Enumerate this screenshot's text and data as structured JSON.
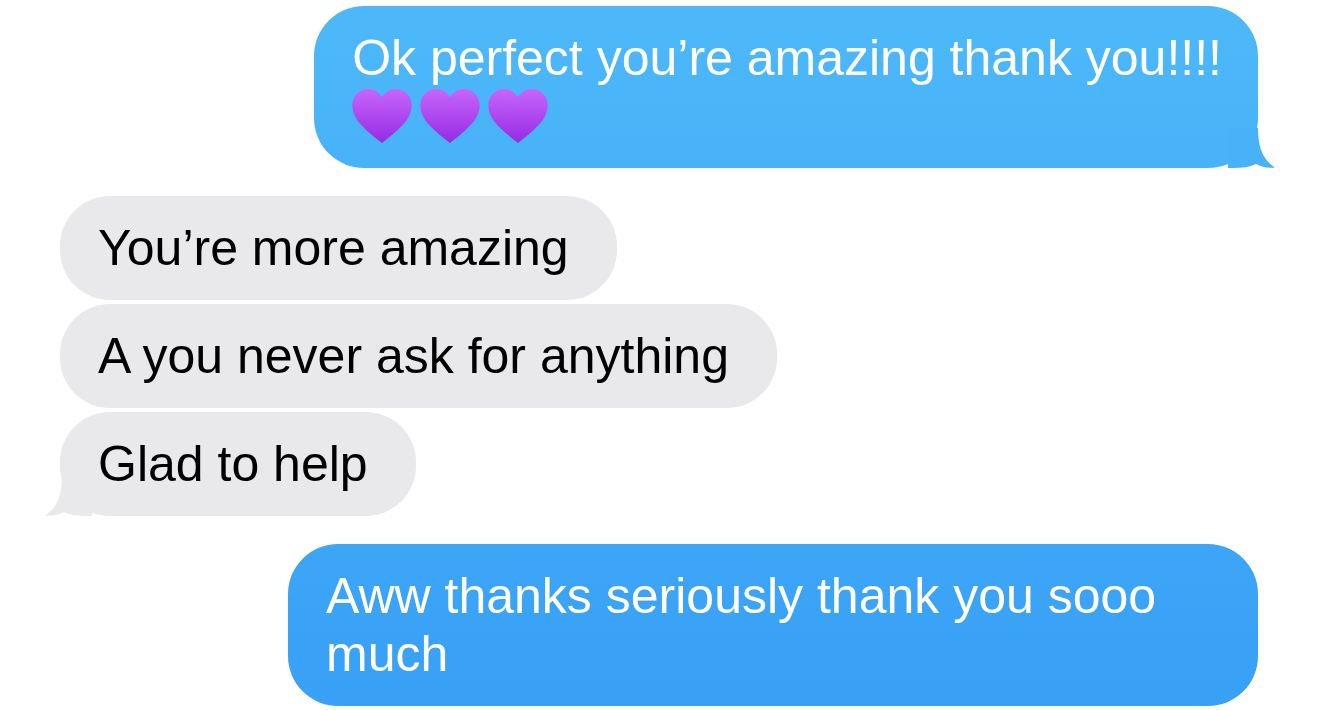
{
  "messages": [
    {
      "kind": "sent",
      "text": "Ok perfect you’re amazing thank you!!!!",
      "emojis": [
        {
          "kind": "heart"
        },
        {
          "kind": "heart"
        },
        {
          "kind": "heart"
        }
      ],
      "tail": true
    },
    {
      "kind": "received",
      "text": "You’re more amazing",
      "tail": false
    },
    {
      "kind": "received",
      "text": "A you never ask for anything",
      "tail": false
    },
    {
      "kind": "received",
      "text": "Glad to help",
      "tail": true
    },
    {
      "kind": "sent",
      "text": "Aww thanks seriously thank you sooo much",
      "tail": false
    }
  ]
}
